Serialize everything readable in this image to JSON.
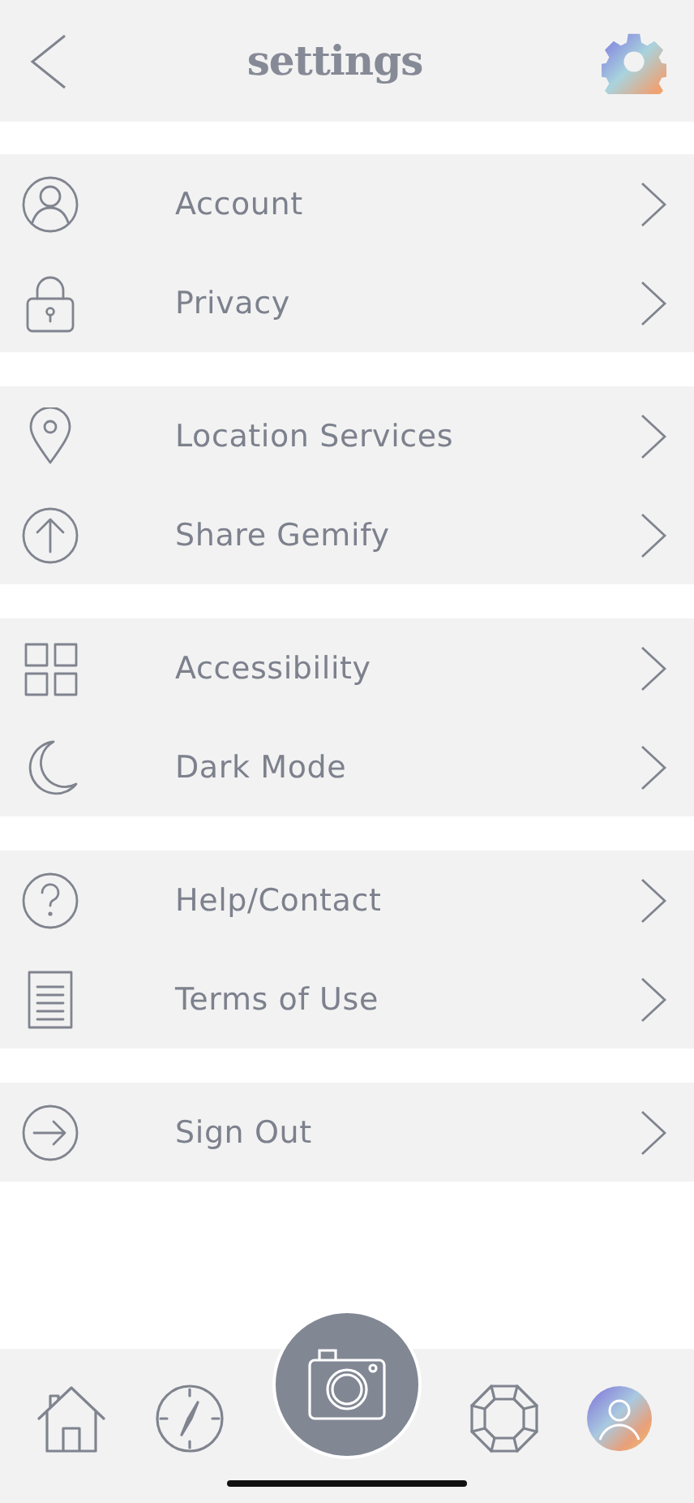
{
  "header": {
    "title": "settings"
  },
  "sections": [
    {
      "items": [
        {
          "label": "Account",
          "kind": "person"
        },
        {
          "label": "Privacy",
          "kind": "lock"
        }
      ]
    },
    {
      "items": [
        {
          "label": "Location Services",
          "kind": "pin"
        },
        {
          "label": "Share Gemify",
          "kind": "share"
        }
      ]
    },
    {
      "items": [
        {
          "label": "Accessibility",
          "kind": "grid"
        },
        {
          "label": "Dark Mode",
          "kind": "moon"
        }
      ]
    },
    {
      "items": [
        {
          "label": "Help/Contact",
          "kind": "help"
        },
        {
          "label": "Terms of Use",
          "kind": "doc"
        }
      ]
    },
    {
      "items": [
        {
          "label": "Sign Out",
          "kind": "signout"
        }
      ]
    }
  ],
  "tab_bar": [
    {
      "kind": "home"
    },
    {
      "kind": "compass"
    },
    {
      "kind": "camera"
    },
    {
      "kind": "gem"
    },
    {
      "kind": "profile"
    }
  ]
}
